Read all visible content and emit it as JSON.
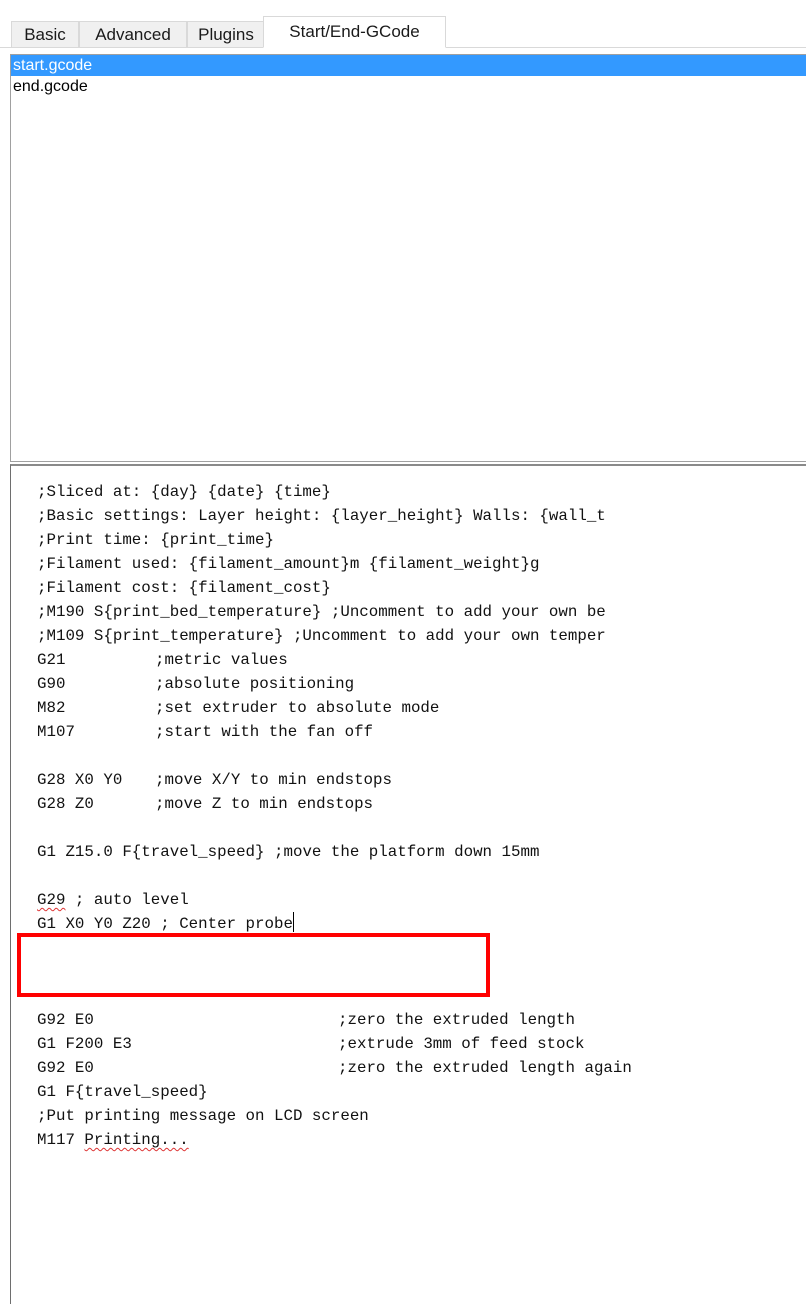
{
  "tabs": [
    {
      "label": "Basic",
      "active": false
    },
    {
      "label": "Advanced",
      "active": false
    },
    {
      "label": "Plugins",
      "active": false
    },
    {
      "label": "Start/End-GCode",
      "active": true
    }
  ],
  "file_list": {
    "items": [
      {
        "label": "start.gcode",
        "selected": true
      },
      {
        "label": "end.gcode",
        "selected": false
      }
    ]
  },
  "editor": {
    "lines": [
      {
        "text": ";Sliced at: {day} {date} {time}"
      },
      {
        "text": ";Basic settings: Layer height: {layer_height} Walls: {wall_t"
      },
      {
        "text": ";Print time: {print_time}"
      },
      {
        "text": ";Filament used: {filament_amount}m {filament_weight}g"
      },
      {
        "text": ";Filament cost: {filament_cost}"
      },
      {
        "text": ";M190 S{print_bed_temperature} ;Uncomment to add your own be"
      },
      {
        "text": ";M109 S{print_temperature} ;Uncomment to add your own temper"
      },
      {
        "cmd": "G21",
        "comment": ";metric values"
      },
      {
        "cmd": "G90",
        "comment": ";absolute positioning"
      },
      {
        "cmd": "M82",
        "comment": ";set extruder to absolute mode"
      },
      {
        "cmd": "M107",
        "comment": ";start with the fan off"
      },
      {
        "text": ""
      },
      {
        "cmd": "G28 X0 Y0",
        "comment": ";move X/Y to min endstops"
      },
      {
        "cmd": "G28 Z0",
        "comment": ";move Z to min endstops"
      },
      {
        "text": ""
      },
      {
        "cmd": "G1 Z15.0 F{travel_speed}",
        "comment": ";move the platform down 15mm"
      },
      {
        "text": ""
      },
      {
        "cmd": "G29",
        "rest": " ; auto level"
      },
      {
        "text": "G1 X0 Y0 Z20 ; Center probe"
      },
      {
        "text": ""
      },
      {
        "text": ""
      },
      {
        "text": ""
      },
      {
        "cmd": "G92 E0",
        "comment": ";zero the extruded length"
      },
      {
        "cmd": "G1 F200 E3",
        "comment": ";extrude 3mm of feed stock"
      },
      {
        "cmd": "G92 E0",
        "comment": ";zero the extruded length again"
      },
      {
        "text": "G1 F{travel_speed}"
      },
      {
        "text": ";Put printing message on LCD screen"
      },
      {
        "cmd": "M117",
        "rest": "Printing..."
      }
    ]
  },
  "colors": {
    "selection": "#3399ff",
    "comment": "#3a8a3a",
    "annotation_box": "#ff0000"
  },
  "icons": []
}
